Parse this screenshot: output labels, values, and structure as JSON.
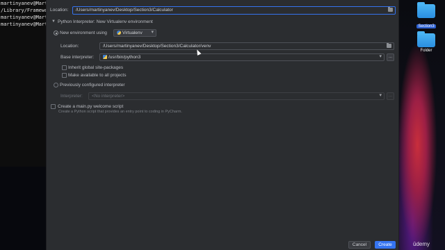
{
  "terminal": {
    "lines": [
      "martinyanev@Marti",
      "/Library/Framewo",
      "martinyanev@Marti",
      "martinyanev@Marti"
    ]
  },
  "desktop": {
    "items": [
      {
        "label": "Section3",
        "selected": true
      },
      {
        "label": "Folder",
        "selected": false
      }
    ],
    "watermark": "ūdemy"
  },
  "dialog": {
    "location_label": "Location:",
    "location_value": "/Users/martinyanev/Desktop/Section3/Calculator",
    "interpreter_section_title": "Python Interpreter: New Virtualenv environment",
    "new_env": {
      "label": "New environment using",
      "selected": true,
      "tool": "Virtualenv",
      "location_label": "Location:",
      "location_value": "/Users/martinyanev/Desktop/Section3/Calculator/venv",
      "base_interpreter_label": "Base interpreter:",
      "base_interpreter_value": "/usr/bin/python3",
      "inherit_label": "Inherit global site-packages",
      "inherit_checked": false,
      "make_available_label": "Make available to all projects",
      "make_available_checked": false
    },
    "previous": {
      "label": "Previously configured interpreter",
      "selected": false,
      "interpreter_label": "Interpreter:",
      "interpreter_placeholder": "<No interpreter>"
    },
    "welcome": {
      "label": "Create a main.py welcome script",
      "checked": false,
      "help": "Create a Python script that provides an entry point to coding in PyCharm."
    },
    "buttons": {
      "cancel": "Cancel",
      "create": "Create"
    },
    "dots": "..."
  },
  "colors": {
    "accent": "#3574f0",
    "dialog_bg": "#2b2d30"
  }
}
